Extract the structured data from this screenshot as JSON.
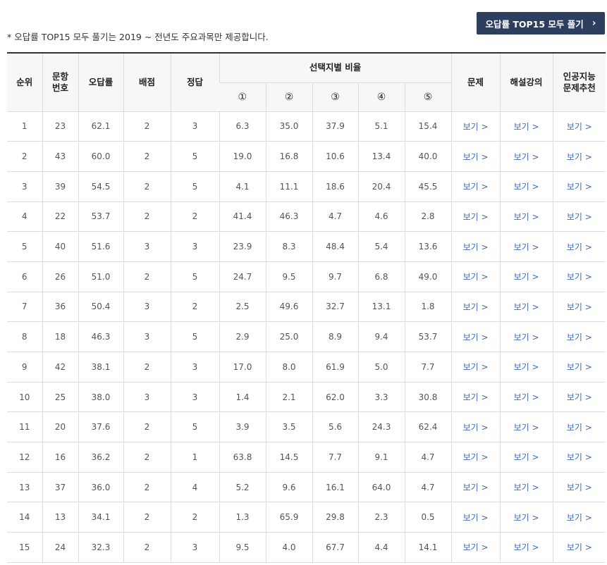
{
  "top_button": {
    "label": "오답률 TOP15 모두 풀기",
    "chevron": "›"
  },
  "note": "* 오답률 TOP15 모두 풀기는 2019 ~ 전년도 주요과목만 제공합니다.",
  "headers": {
    "rank": "순위",
    "qnum_line1": "문항",
    "qnum_line2": "번호",
    "error_rate": "오답률",
    "points": "배점",
    "answer": "정답",
    "choice_ratio": "선택지별 비율",
    "choices": [
      "①",
      "②",
      "③",
      "④",
      "⑤"
    ],
    "problem": "문제",
    "lecture": "해설강의",
    "ai_line1": "인공지능",
    "ai_line2": "문제추천"
  },
  "link_label": "보기 >",
  "rows": [
    {
      "rank": "1",
      "qnum": "23",
      "rate": "62.1",
      "points": "2",
      "answer": "3",
      "c": [
        "6.3",
        "35.0",
        "37.9",
        "5.1",
        "15.4"
      ]
    },
    {
      "rank": "2",
      "qnum": "43",
      "rate": "60.0",
      "points": "2",
      "answer": "5",
      "c": [
        "19.0",
        "16.8",
        "10.6",
        "13.4",
        "40.0"
      ]
    },
    {
      "rank": "3",
      "qnum": "39",
      "rate": "54.5",
      "points": "2",
      "answer": "5",
      "c": [
        "4.1",
        "11.1",
        "18.6",
        "20.4",
        "45.5"
      ]
    },
    {
      "rank": "4",
      "qnum": "22",
      "rate": "53.7",
      "points": "2",
      "answer": "2",
      "c": [
        "41.4",
        "46.3",
        "4.7",
        "4.6",
        "2.8"
      ]
    },
    {
      "rank": "5",
      "qnum": "40",
      "rate": "51.6",
      "points": "3",
      "answer": "3",
      "c": [
        "23.9",
        "8.3",
        "48.4",
        "5.4",
        "13.6"
      ]
    },
    {
      "rank": "6",
      "qnum": "26",
      "rate": "51.0",
      "points": "2",
      "answer": "5",
      "c": [
        "24.7",
        "9.5",
        "9.7",
        "6.8",
        "49.0"
      ]
    },
    {
      "rank": "7",
      "qnum": "36",
      "rate": "50.4",
      "points": "3",
      "answer": "2",
      "c": [
        "2.5",
        "49.6",
        "32.7",
        "13.1",
        "1.8"
      ]
    },
    {
      "rank": "8",
      "qnum": "18",
      "rate": "46.3",
      "points": "3",
      "answer": "5",
      "c": [
        "2.9",
        "25.0",
        "8.9",
        "9.4",
        "53.7"
      ]
    },
    {
      "rank": "9",
      "qnum": "42",
      "rate": "38.1",
      "points": "2",
      "answer": "3",
      "c": [
        "17.0",
        "8.0",
        "61.9",
        "5.0",
        "7.7"
      ]
    },
    {
      "rank": "10",
      "qnum": "25",
      "rate": "38.0",
      "points": "3",
      "answer": "3",
      "c": [
        "1.4",
        "2.1",
        "62.0",
        "3.3",
        "30.8"
      ]
    },
    {
      "rank": "11",
      "qnum": "20",
      "rate": "37.6",
      "points": "2",
      "answer": "5",
      "c": [
        "3.9",
        "3.5",
        "5.6",
        "24.3",
        "62.4"
      ]
    },
    {
      "rank": "12",
      "qnum": "16",
      "rate": "36.2",
      "points": "2",
      "answer": "1",
      "c": [
        "63.8",
        "14.5",
        "7.7",
        "9.1",
        "4.7"
      ]
    },
    {
      "rank": "13",
      "qnum": "37",
      "rate": "36.0",
      "points": "2",
      "answer": "4",
      "c": [
        "5.2",
        "9.6",
        "16.1",
        "64.0",
        "4.7"
      ]
    },
    {
      "rank": "14",
      "qnum": "13",
      "rate": "34.1",
      "points": "2",
      "answer": "2",
      "c": [
        "1.3",
        "65.9",
        "29.8",
        "2.3",
        "0.5"
      ]
    },
    {
      "rank": "15",
      "qnum": "24",
      "rate": "32.3",
      "points": "2",
      "answer": "3",
      "c": [
        "9.5",
        "4.0",
        "67.7",
        "4.4",
        "14.1"
      ]
    }
  ]
}
